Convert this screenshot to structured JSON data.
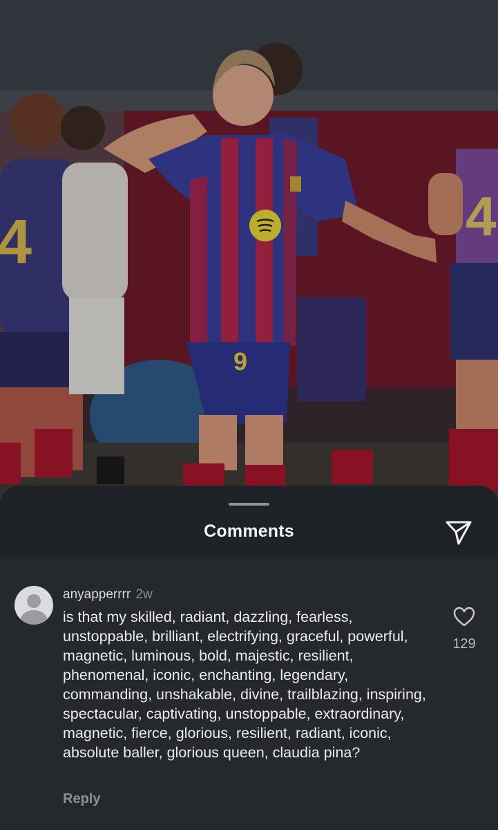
{
  "sheet": {
    "title": "Comments"
  },
  "icons": {
    "share": "paper-plane-icon",
    "like": "heart-outline-icon",
    "avatar": "default-avatar-icon"
  },
  "comment": {
    "username": "anyapperrrr",
    "timestamp": "2w",
    "text": "is that my skilled, radiant, dazzling, fearless, unstoppable, brilliant, electrifying, graceful, powerful, magnetic, luminous, bold, majestic, resilient, phenomenal, iconic, enchanting, legendary, commanding, unshakable, divine, trailblazing, inspiring, spectacular, captivating, unstoppable, extraordinary, magnetic, fierce, glorious, resilient, radiant, iconic, absolute baller, glorious queen, claudia pina?",
    "like_count": "129",
    "reply_label": "Reply"
  },
  "photo": {
    "jersey_number": "9"
  },
  "colors": {
    "sheet_bg": "#25282d",
    "header_bg": "#1f2226",
    "text_primary": "#ececec",
    "text_secondary": "#8d9096"
  }
}
